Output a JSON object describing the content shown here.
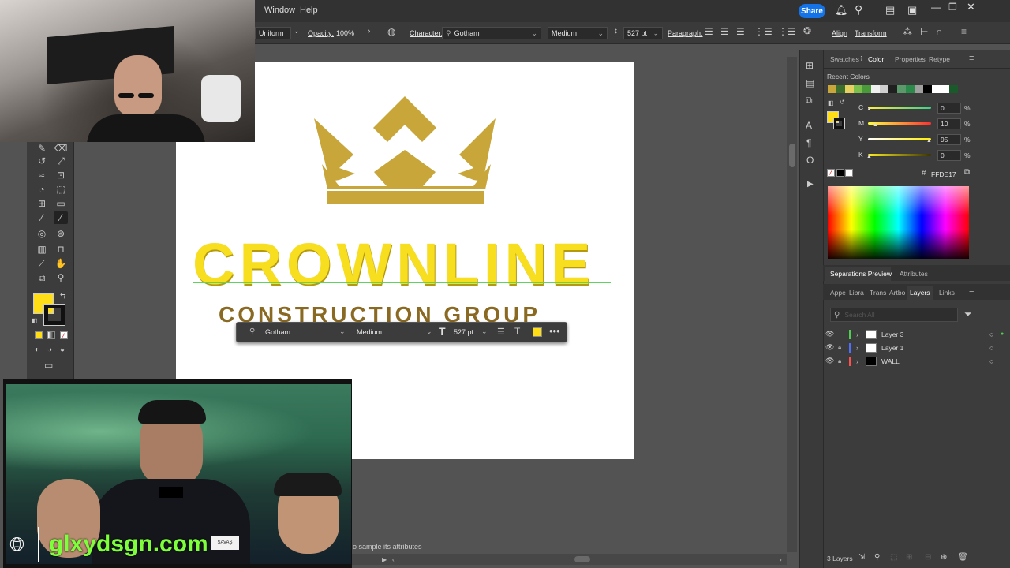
{
  "menubar": {
    "items": [
      "Window",
      "Help"
    ],
    "share_label": "Share"
  },
  "controlbar": {
    "stroke_profile": "Uniform",
    "opacity_label": "Opacity:",
    "opacity_value": "100%",
    "character_label": "Character:",
    "font_family": "Gotham",
    "font_style": "Medium",
    "font_size": "527 pt",
    "paragraph_label": "Paragraph:",
    "align_label": "Align",
    "transform_label": "Transform"
  },
  "artboard": {
    "logo_word": "CROWNLINE",
    "logo_sub": "CONSTRUCTION GROUP",
    "brand_gold": "#c9a63a",
    "brand_yellow": "#ffde17"
  },
  "floatbar": {
    "font_family": "Gotham",
    "font_style": "Medium",
    "font_size": "527 pt",
    "fill": "#ffde17"
  },
  "status": {
    "hint": "o sample its attributes"
  },
  "color_panel": {
    "tabs": [
      "Swatches",
      "Color",
      "Properties",
      "Retype"
    ],
    "active_tab": "Color",
    "recent_label": "Recent Colors",
    "recent_colors": [
      "#c9a63a",
      "#3a6e2a",
      "#e6d060",
      "#7ac04a",
      "#4a9a3a",
      "#f0f0f0",
      "#d0d0d0",
      "#202020",
      "#5a9a6a",
      "#2a8a4a",
      "#a0a0a0",
      "#000000",
      "#ffffff",
      "#ffffff",
      "#1a5a2a"
    ],
    "channels": [
      {
        "label": "C",
        "value": "0"
      },
      {
        "label": "M",
        "value": "10"
      },
      {
        "label": "Y",
        "value": "95"
      },
      {
        "label": "K",
        "value": "0"
      }
    ],
    "percent": "%",
    "hex_value": "FFDE17"
  },
  "separations": {
    "tabs": [
      "Separations Preview",
      "Attributes"
    ]
  },
  "layers_panel": {
    "tabs": [
      "Appe",
      "Libra",
      "Trans",
      "Artbo",
      "Layers",
      "Links"
    ],
    "active_tab": "Layers",
    "search_placeholder": "Search All",
    "layers": [
      {
        "name": "Layer 3",
        "color": "#4fce4f"
      },
      {
        "name": "Layer 1",
        "color": "#4f6fff"
      },
      {
        "name": "WALL",
        "color": "#ff4f4f"
      }
    ],
    "count_label": "3 Layers"
  },
  "overlay": {
    "site": "glxydsgn.com",
    "name_tag": "SAVAŞ"
  }
}
